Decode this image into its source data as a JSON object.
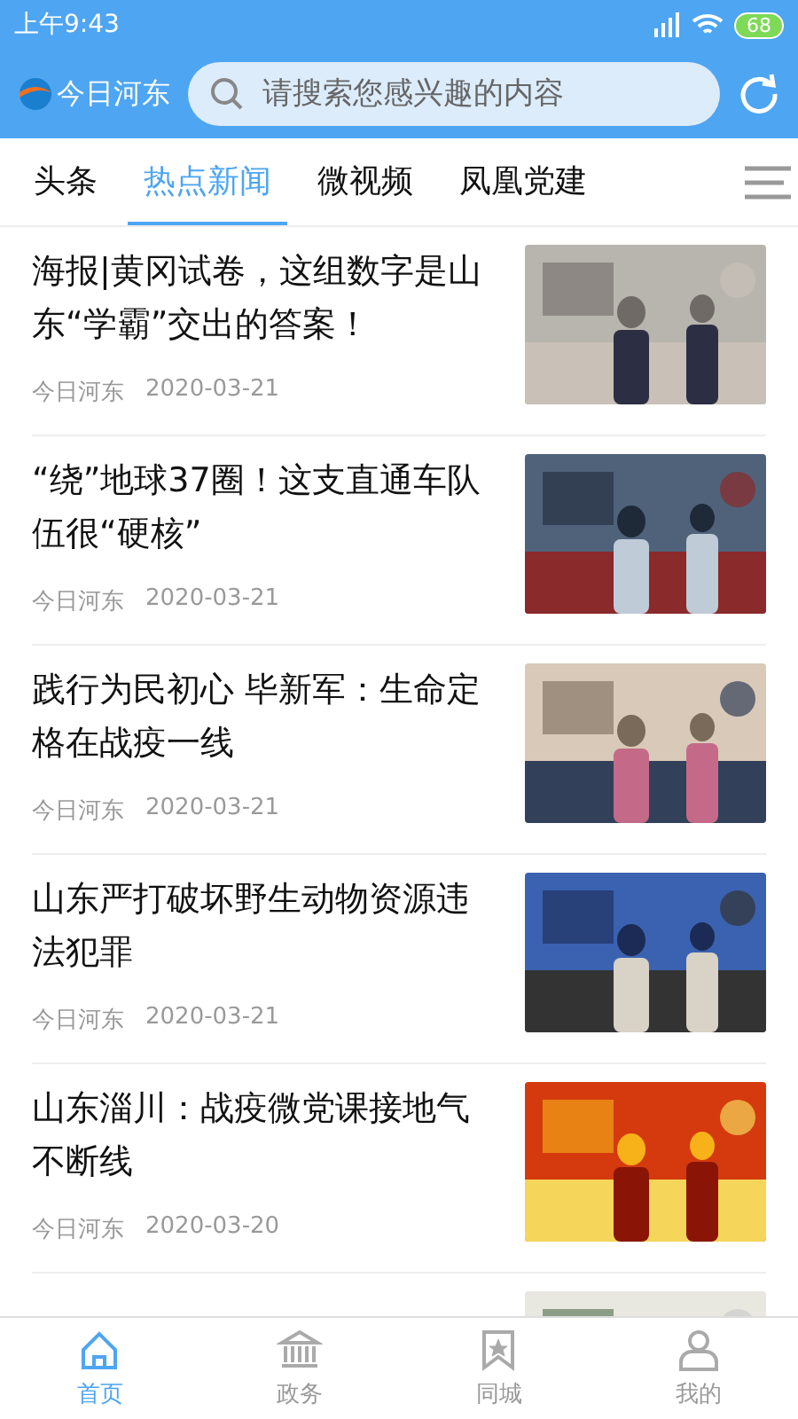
{
  "status_bar": {
    "time": "上午9:43",
    "battery": "68"
  },
  "header": {
    "app_name": "今日河东",
    "search": {
      "placeholder": "请搜索您感兴趣的内容"
    }
  },
  "tabs": [
    {
      "label": "头条",
      "selected": false
    },
    {
      "label": "热点新闻",
      "selected": true
    },
    {
      "label": "微视频",
      "selected": false
    },
    {
      "label": "凤凰党建",
      "selected": false
    }
  ],
  "articles": [
    {
      "title": "海报|黄冈试卷，这组数字是山东“学霸”交出的答案！",
      "source": "今日河东",
      "date": "2020-03-21",
      "picture": {
        "kind": "picture"
      }
    },
    {
      "title": "“绕”地球37圈！这支直通车队伍很“硬核”",
      "source": "今日河东",
      "date": "2020-03-21",
      "picture": {
        "kind": "picture"
      }
    },
    {
      "title": "践行为民初心 毕新军：生命定格在战疫一线",
      "source": "今日河东",
      "date": "2020-03-21",
      "picture": {
        "kind": "picture"
      }
    },
    {
      "title": "山东严打破坏野生动物资源违法犯罪",
      "source": "今日河东",
      "date": "2020-03-21",
      "picture": {
        "kind": "picture"
      }
    },
    {
      "title": "山东淄川：战疫微党课接地气不断线",
      "source": "今日河东",
      "date": "2020-03-20",
      "picture": {
        "kind": "picture"
      }
    },
    {
      "picture": {
        "kind": "picture"
      }
    }
  ],
  "bottom_nav": [
    {
      "label": "首页",
      "selected": true
    },
    {
      "label": "政务",
      "selected": false
    },
    {
      "label": "同城",
      "selected": false
    },
    {
      "label": "我的",
      "selected": false
    }
  ]
}
